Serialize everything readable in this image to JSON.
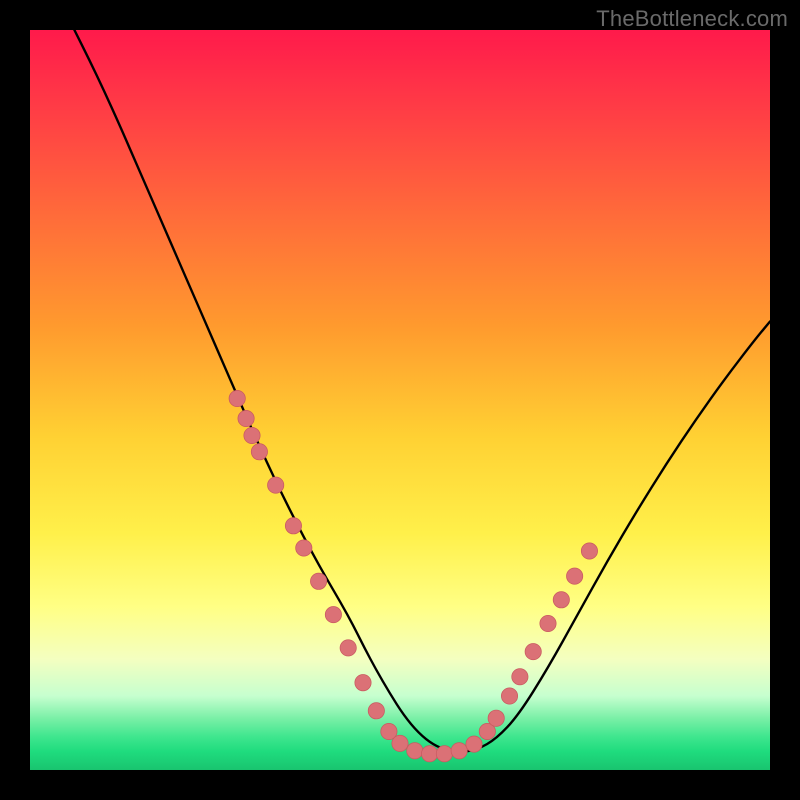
{
  "watermark": "TheBottleneck.com",
  "colors": {
    "frame": "#000000",
    "curve": "#000000",
    "marker_fill": "#db7176",
    "marker_stroke": "#c95a60",
    "gradient_stops": [
      {
        "offset": 0.0,
        "color": "#ff1a4b"
      },
      {
        "offset": 0.1,
        "color": "#ff3a46"
      },
      {
        "offset": 0.25,
        "color": "#ff6b3a"
      },
      {
        "offset": 0.4,
        "color": "#ff9a2e"
      },
      {
        "offset": 0.55,
        "color": "#ffd133"
      },
      {
        "offset": 0.68,
        "color": "#fff04a"
      },
      {
        "offset": 0.78,
        "color": "#ffff85"
      },
      {
        "offset": 0.85,
        "color": "#f4ffc0"
      },
      {
        "offset": 0.9,
        "color": "#c6ffcf"
      },
      {
        "offset": 0.93,
        "color": "#7af0a7"
      },
      {
        "offset": 0.955,
        "color": "#3fe68e"
      },
      {
        "offset": 0.975,
        "color": "#1fdc7e"
      },
      {
        "offset": 1.0,
        "color": "#19c46f"
      }
    ]
  },
  "chart_data": {
    "type": "line",
    "title": "",
    "xlabel": "",
    "ylabel": "",
    "xlim": [
      0,
      1000
    ],
    "ylim": [
      0,
      1000
    ],
    "grid": false,
    "series": [
      {
        "name": "bottleneck-curve",
        "x": [
          60,
          80,
          100,
          120,
          140,
          160,
          180,
          200,
          220,
          240,
          260,
          280,
          300,
          320,
          340,
          360,
          380,
          400,
          420,
          437,
          452,
          468,
          486,
          505,
          525,
          545,
          565,
          585,
          605,
          630,
          660,
          700,
          740,
          780,
          820,
          860,
          900,
          940,
          980,
          1000
        ],
        "y": [
          1000,
          960,
          918,
          874,
          828,
          782,
          736,
          690,
          644,
          598,
          552,
          506,
          460,
          416,
          374,
          334,
          296,
          260,
          226,
          195,
          165,
          135,
          104,
          74,
          50,
          34,
          26,
          24,
          28,
          42,
          74,
          138,
          210,
          282,
          350,
          414,
          474,
          530,
          582,
          606
        ]
      }
    ],
    "markers": {
      "name": "highlighted-points",
      "points_left": [
        {
          "x": 280,
          "y": 502
        },
        {
          "x": 292,
          "y": 475
        },
        {
          "x": 300,
          "y": 452
        },
        {
          "x": 310,
          "y": 430
        },
        {
          "x": 332,
          "y": 385
        },
        {
          "x": 356,
          "y": 330
        },
        {
          "x": 370,
          "y": 300
        },
        {
          "x": 390,
          "y": 255
        },
        {
          "x": 410,
          "y": 210
        },
        {
          "x": 430,
          "y": 165
        },
        {
          "x": 450,
          "y": 118
        },
        {
          "x": 468,
          "y": 80
        },
        {
          "x": 485,
          "y": 52
        }
      ],
      "points_bottom": [
        {
          "x": 500,
          "y": 36
        },
        {
          "x": 520,
          "y": 26
        },
        {
          "x": 540,
          "y": 22
        },
        {
          "x": 560,
          "y": 22
        },
        {
          "x": 580,
          "y": 26
        },
        {
          "x": 600,
          "y": 35
        }
      ],
      "points_right": [
        {
          "x": 618,
          "y": 52
        },
        {
          "x": 630,
          "y": 70
        },
        {
          "x": 648,
          "y": 100
        },
        {
          "x": 662,
          "y": 126
        },
        {
          "x": 680,
          "y": 160
        },
        {
          "x": 700,
          "y": 198
        },
        {
          "x": 718,
          "y": 230
        },
        {
          "x": 736,
          "y": 262
        },
        {
          "x": 756,
          "y": 296
        }
      ]
    }
  }
}
